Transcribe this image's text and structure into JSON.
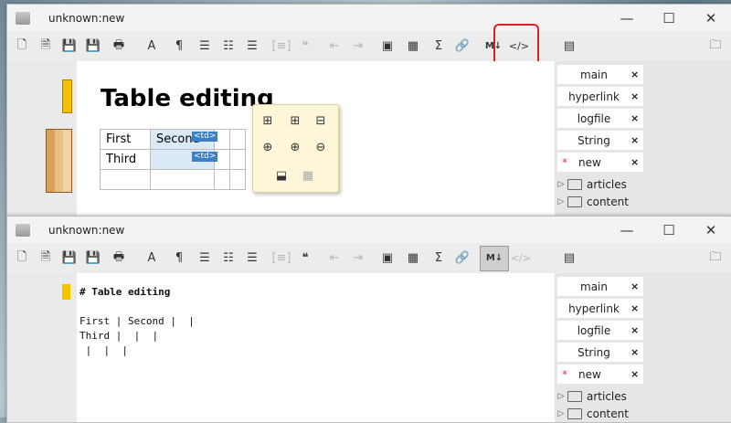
{
  "top_window": {
    "title": "unknown:new",
    "heading": "Table editing",
    "table": [
      [
        "First",
        "Second"
      ],
      [
        "Third",
        ""
      ]
    ],
    "td_tag": "<td>",
    "popup_icons": [
      "insert-column-left-icon",
      "insert-column-right-icon",
      "delete-column-icon",
      "insert-row-above-icon",
      "insert-row-below-icon",
      "delete-row-icon",
      "merge-cells-icon",
      "table-grid-icon"
    ]
  },
  "bottom_window": {
    "title": "unknown:new",
    "markdown_lines": [
      "# Table editing",
      "",
      "First | Second |  |",
      "Third |  |  |",
      " |  |  |"
    ]
  },
  "window_controls": {
    "minimize": "—",
    "maximize": "☐",
    "close": "✕"
  },
  "toolbar": {
    "bold_label": "A",
    "pilcrow": "¶",
    "quote": "❝",
    "sigma": "Σ",
    "markdown_toggle": "M↓",
    "source_toggle": "</>"
  },
  "sidebar": {
    "tabs": [
      {
        "label": "main",
        "close": "×",
        "active": false
      },
      {
        "label": "hyperlink",
        "close": "×",
        "active": false
      },
      {
        "label": "logfile",
        "close": "×",
        "active": false
      },
      {
        "label": "String",
        "close": "×",
        "active": false
      },
      {
        "label": "new",
        "close": "×",
        "active": true,
        "modified": "*"
      }
    ],
    "folders": [
      {
        "label": "articles"
      },
      {
        "label": "content"
      }
    ]
  },
  "colors": {
    "highlight": "#e02020",
    "accent": "#3b7fc4",
    "marker": "#f2c200"
  }
}
